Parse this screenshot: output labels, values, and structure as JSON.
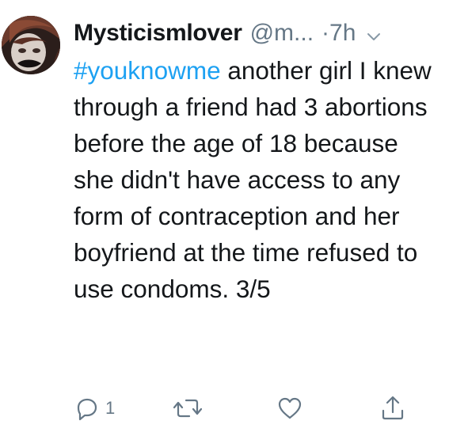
{
  "tweet": {
    "display_name": "Mysticismlover",
    "handle": "@m...",
    "time": "·7h",
    "hashtag": "#youknowme",
    "text": " another girl I knew through a friend had 3 abortions before the age of 18 because she didn't have access to any form of contraception and her boyfriend at the time refused to use condoms. 3/5",
    "reply_count": "1"
  },
  "icons": {
    "caret": "chevron-down-icon",
    "reply": "reply-icon",
    "retweet": "retweet-icon",
    "like": "heart-icon",
    "share": "share-icon"
  },
  "colors": {
    "text": "#14171a",
    "secondary": "#657786",
    "link": "#1da1f2",
    "background": "#ffffff"
  }
}
